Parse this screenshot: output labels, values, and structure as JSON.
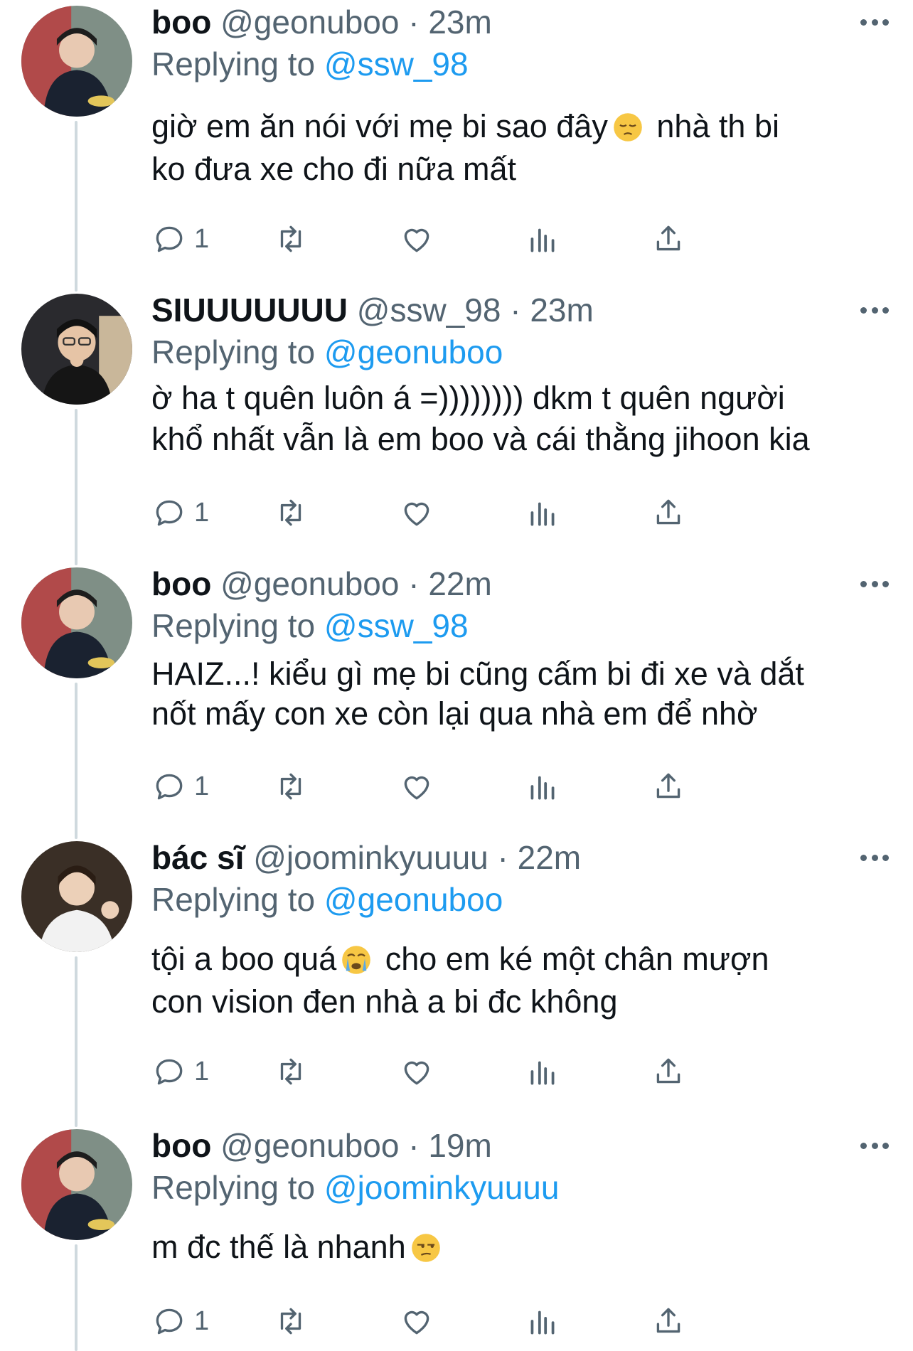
{
  "tweets": [
    {
      "name": "boo",
      "handle": "@geonuboo",
      "sep": "·",
      "time": "23m",
      "replying_label": "Replying to",
      "replying_to": "@ssw_98",
      "text_before": "giờ em ăn nói với mẹ bi sao đây",
      "emoji": "pensive-face-emoji",
      "text_after": " nhà th bi\nko đưa xe cho đi nữa mất",
      "reply_count": "1",
      "avatar": "boo-avatar"
    },
    {
      "name": "SIUUUUUUU",
      "handle": "@ssw_98",
      "sep": "·",
      "time": "23m",
      "replying_label": "Replying to",
      "replying_to": "@geonuboo",
      "text_before": "ờ ha t quên luôn á =)))))))) dkm t quên người\nkhổ nhất vẫn là em boo và cái thằng jihoon kia",
      "emoji": "",
      "text_after": "",
      "reply_count": "1",
      "avatar": "siu-avatar"
    },
    {
      "name": "boo",
      "handle": "@geonuboo",
      "sep": "·",
      "time": "22m",
      "replying_label": "Replying to",
      "replying_to": "@ssw_98",
      "text_before": "HAIZ...! kiểu gì mẹ bi cũng cấm bi đi xe và dắt\nnốt mấy con xe còn lại qua nhà em để nhờ",
      "emoji": "",
      "text_after": "",
      "reply_count": "1",
      "avatar": "boo-avatar"
    },
    {
      "name": "bác sĩ",
      "handle": "@joominkyuuuu",
      "sep": "·",
      "time": "22m",
      "replying_label": "Replying to",
      "replying_to": "@geonuboo",
      "text_before": "tội a boo quá",
      "emoji": "crying-face-emoji",
      "text_after": " cho em ké một chân mượn\ncon vision đen nhà a bi đc không",
      "reply_count": "1",
      "avatar": "doctor-avatar"
    },
    {
      "name": "boo",
      "handle": "@geonuboo",
      "sep": "·",
      "time": "19m",
      "replying_label": "Replying to",
      "replying_to": "@joominkyuuuu",
      "text_before": "m đc thế là nhanh",
      "emoji": "unamused-face-emoji",
      "text_after": "",
      "reply_count": "1",
      "avatar": "boo-avatar"
    }
  ],
  "colors": {
    "link": "#1d9bf0",
    "secondary_text": "#536471",
    "thread_line": "#cfd9de"
  }
}
